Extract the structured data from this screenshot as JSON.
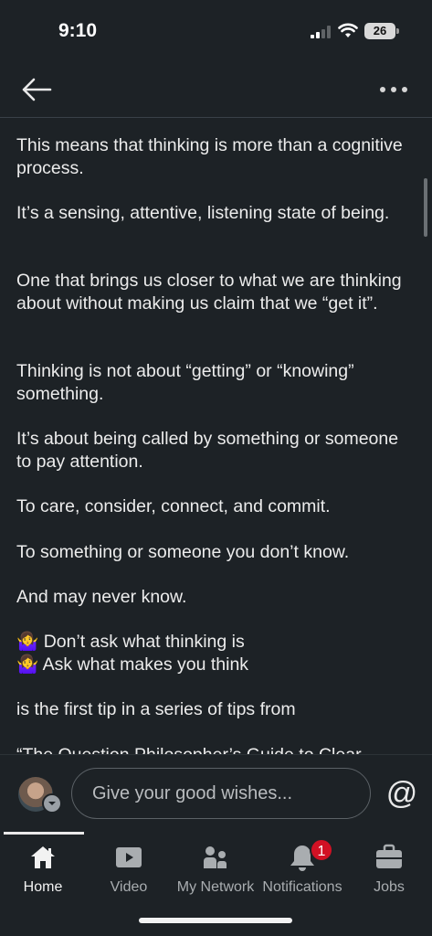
{
  "status_bar": {
    "time": "9:10",
    "battery": "26"
  },
  "header": {
    "back_icon": "arrow-left-icon",
    "more_icon": "ellipsis-icon"
  },
  "post": {
    "paragraphs": [
      "This means that thinking is more than a cognitive process.",
      "It’s a sensing, attentive, listening state of being.",
      "One that brings us closer to what we are thinking about without making us claim that we “get it”.",
      "Thinking is not about “getting” or “knowing” something.",
      "It’s about being called by something or someone to pay attention.",
      "To care, consider, connect, and commit.",
      "To something or someone you don’t know.",
      "And may never know.",
      "🤷‍♀️ Don’t ask what thinking is",
      "🤷‍♀️ Ask what makes you think",
      "is the first tip in a series of tips from",
      "“The Question Philosopher’s Guide to Clear"
    ]
  },
  "comment": {
    "placeholder": "Give your good wishes...",
    "mention_symbol": "@"
  },
  "tabs": [
    {
      "label": "Home",
      "icon": "home-icon",
      "active": true
    },
    {
      "label": "Video",
      "icon": "video-icon"
    },
    {
      "label": "My Network",
      "icon": "network-icon"
    },
    {
      "label": "Notifications",
      "icon": "bell-icon",
      "badge": "1"
    },
    {
      "label": "Jobs",
      "icon": "briefcase-icon"
    }
  ],
  "colors": {
    "background": "#1d2226",
    "badge": "#d11124",
    "text": "#e9e9e9"
  }
}
